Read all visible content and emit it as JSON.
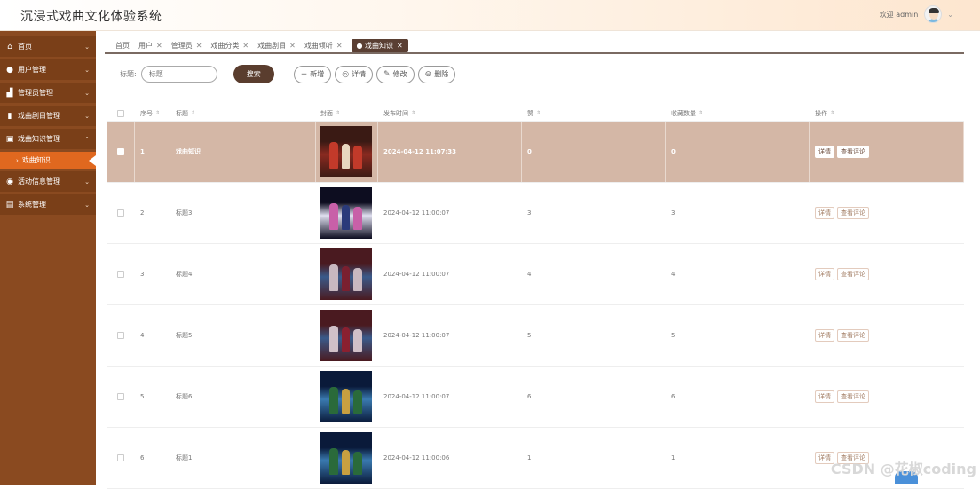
{
  "app": {
    "title": "沉浸式戏曲文化体验系统"
  },
  "user": {
    "greeting": "欢迎 admin",
    "caret": "⌄"
  },
  "sidebar": {
    "items": [
      {
        "icon": "home-icon",
        "glyph": "⌂",
        "label": "首页",
        "chev": "⌄"
      },
      {
        "icon": "user-icon",
        "glyph": "●",
        "label": "用户管理",
        "chev": "⌄"
      },
      {
        "icon": "admin-icon",
        "glyph": "▟",
        "label": "管理员管理",
        "chev": "⌄"
      },
      {
        "icon": "repertoire-icon",
        "glyph": "▮",
        "label": "戏曲剧目管理",
        "chev": "⌄"
      },
      {
        "icon": "knowledge-icon",
        "glyph": "▣",
        "label": "戏曲知识管理",
        "chev": "⌃"
      },
      {
        "icon": "activity-icon",
        "glyph": "◉",
        "label": "活动信息管理",
        "chev": "⌄"
      },
      {
        "icon": "system-icon",
        "glyph": "▤",
        "label": "系统管理",
        "chev": "⌄"
      }
    ],
    "sub_active": "戏曲知识",
    "sub_dot": "›"
  },
  "tabs": [
    {
      "label": "首页",
      "closable": false
    },
    {
      "label": "用户",
      "closable": true
    },
    {
      "label": "管理员",
      "closable": true
    },
    {
      "label": "戏曲分类",
      "closable": true
    },
    {
      "label": "戏曲剧目",
      "closable": true
    },
    {
      "label": "戏曲倾听",
      "closable": true
    },
    {
      "label": "● 戏曲知识",
      "closable": true,
      "active": true
    }
  ],
  "tab_close": "✕",
  "toolbar": {
    "title_label": "标题:",
    "title_placeholder": "标题",
    "search": "搜索",
    "add": "新增",
    "add_glyph": "+",
    "detail": "详情",
    "detail_glyph": "◎",
    "edit": "修改",
    "edit_glyph": "✎",
    "delete": "删除",
    "delete_glyph": "⊖"
  },
  "table": {
    "headers": [
      "序号",
      "标题",
      "封面",
      "发布时间",
      "赞",
      "收藏数量",
      "操作"
    ],
    "sort_glyph": "⇕",
    "actions": [
      "详情",
      "查看评论"
    ],
    "rows": [
      {
        "no": "1",
        "title": "戏曲知识",
        "time": "2024-04-12 11:07:33",
        "likes": "0",
        "favs": "0",
        "palette": [
          "#3a1a14",
          "#c23a2a",
          "#e8d7c0",
          "#8a2a20"
        ]
      },
      {
        "no": "2",
        "title": "标题3",
        "time": "2024-04-12 11:00:07",
        "likes": "3",
        "favs": "3",
        "palette": [
          "#0d0d20",
          "#c860a8",
          "#2a3a7a",
          "#e0e0f0"
        ]
      },
      {
        "no": "3",
        "title": "标题4",
        "time": "2024-04-12 11:00:07",
        "likes": "4",
        "favs": "4",
        "palette": [
          "#4a1a20",
          "#c8b8c0",
          "#7a2030",
          "#3a5a8a"
        ]
      },
      {
        "no": "4",
        "title": "标题5",
        "time": "2024-04-12 11:00:07",
        "likes": "5",
        "favs": "5",
        "palette": [
          "#4a1a20",
          "#d0c0c8",
          "#8a2030",
          "#3a5a8a"
        ]
      },
      {
        "no": "5",
        "title": "标题6",
        "time": "2024-04-12 11:00:07",
        "likes": "6",
        "favs": "6",
        "palette": [
          "#0a1a3a",
          "#2a6a3a",
          "#c8a040",
          "#3a7ab0"
        ]
      },
      {
        "no": "6",
        "title": "标题1",
        "time": "2024-04-12 11:00:06",
        "likes": "1",
        "favs": "1",
        "palette": [
          "#0a1a3a",
          "#2a6a3a",
          "#c8a040",
          "#3a7ab0"
        ]
      }
    ]
  },
  "watermark": "CSDN @花椒coding"
}
